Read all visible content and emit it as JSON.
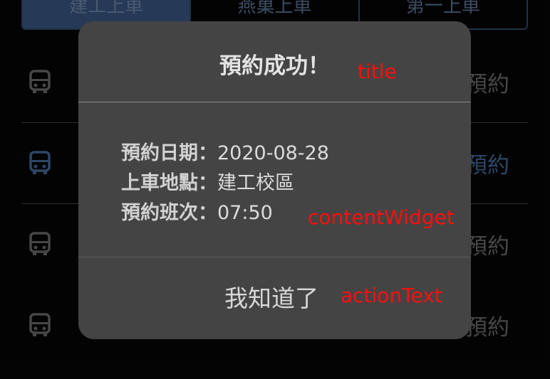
{
  "tabs": [
    {
      "label": "建工上車",
      "active": true
    },
    {
      "label": "燕巢上車",
      "active": false
    },
    {
      "label": "第一上車",
      "active": false
    }
  ],
  "list": {
    "items": [
      {
        "icon": "bus-icon",
        "action": "預約",
        "highlight": false
      },
      {
        "icon": "bus-icon",
        "action": "預約",
        "highlight": true
      },
      {
        "icon": "bus-icon",
        "action": "預約",
        "highlight": false
      },
      {
        "icon": "bus-icon",
        "action": "預約",
        "highlight": false
      }
    ]
  },
  "dialog": {
    "title": "預約成功！",
    "content": [
      {
        "key": "預約日期：",
        "value": "2020-08-28"
      },
      {
        "key": "上車地點：",
        "value": "建工校區"
      },
      {
        "key": "預約班次：",
        "value": "07:50"
      }
    ],
    "action_text": "我知道了"
  },
  "annotations": {
    "title": "title",
    "content": "contentWidget",
    "action": "actionText"
  },
  "colors": {
    "accent": "#3b5a86",
    "dialog_bg": "#444444",
    "annotation": "#ff0d0d"
  }
}
